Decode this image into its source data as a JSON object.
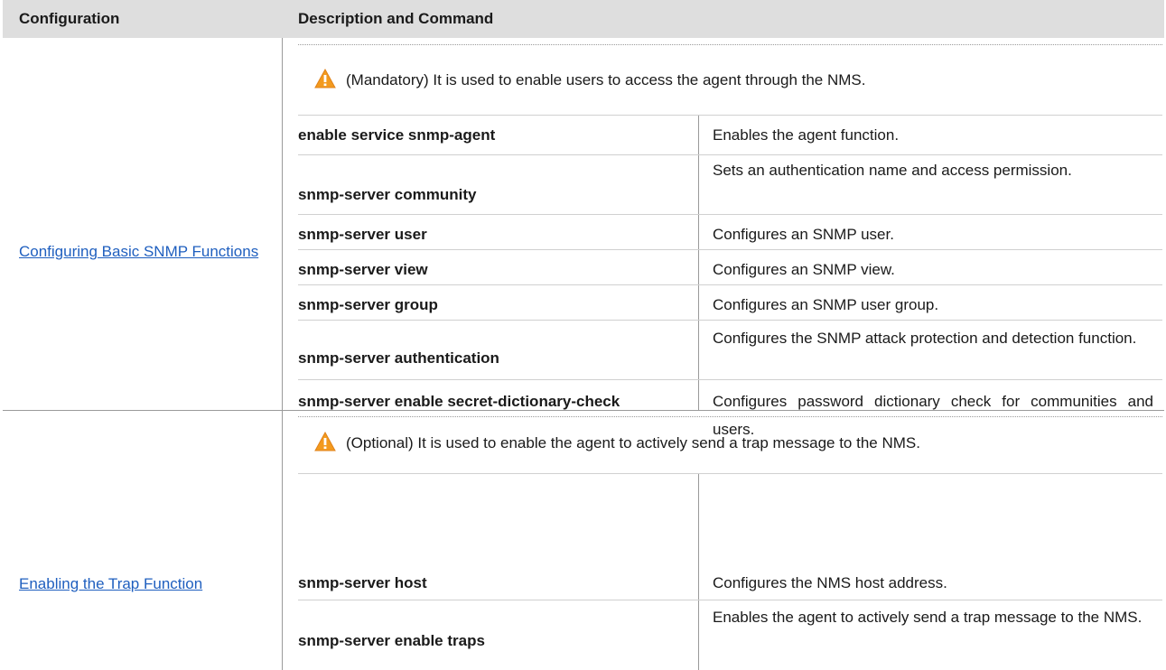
{
  "table": {
    "headers": [
      "Configuration",
      "Description and Command"
    ],
    "sections": [
      {
        "configuration": "Configuring Basic SNMP Functions",
        "note": "(Mandatory) It is used to enable users to access the agent through the NMS.",
        "note_icon": "warning-icon",
        "rows": [
          {
            "command": "enable service snmp-agent",
            "description": "Enables the agent function."
          },
          {
            "command": "snmp-server community",
            "description": "Sets an authentication name and access permission."
          },
          {
            "command": "snmp-server user",
            "description": "Configures an SNMP user."
          },
          {
            "command": "snmp-server view",
            "description": "Configures an SNMP view."
          },
          {
            "command": "snmp-server group",
            "description": "Configures an SNMP user group."
          },
          {
            "command": "snmp-server authentication",
            "description": "Configures the SNMP attack protection and detection function."
          },
          {
            "command": "snmp-server enable secret-dictionary-check",
            "description": "Configures password dictionary check for communities and users."
          }
        ]
      },
      {
        "configuration": "Enabling the Trap Function",
        "note": "(Optional) It is used to enable the agent to actively send a trap message to the NMS.",
        "note_icon": "warning-icon",
        "rows": [
          {
            "command": "snmp-server host",
            "description": "Configures the NMS host address."
          },
          {
            "command": "snmp-server enable traps",
            "description": "Enables the agent to actively send a trap message to the NMS."
          }
        ]
      }
    ]
  },
  "colors": {
    "header_bg": "#dedede",
    "link": "#1f5fbf",
    "warning_orange": "#f39a1d",
    "warning_mark": "#ffffff"
  }
}
